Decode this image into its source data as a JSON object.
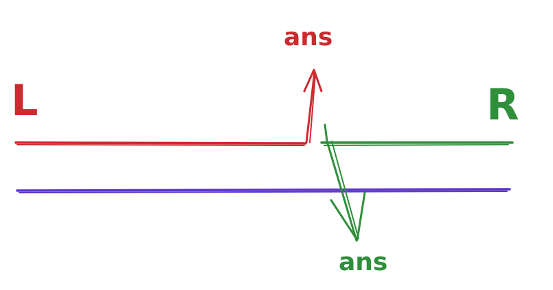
{
  "colors": {
    "red": "#cd2a30",
    "green": "#2f8f3a",
    "purple": "#5b35c9"
  },
  "labels": {
    "left": "L",
    "right": "R",
    "top_answer": "ans",
    "bottom_answer": "ans"
  }
}
